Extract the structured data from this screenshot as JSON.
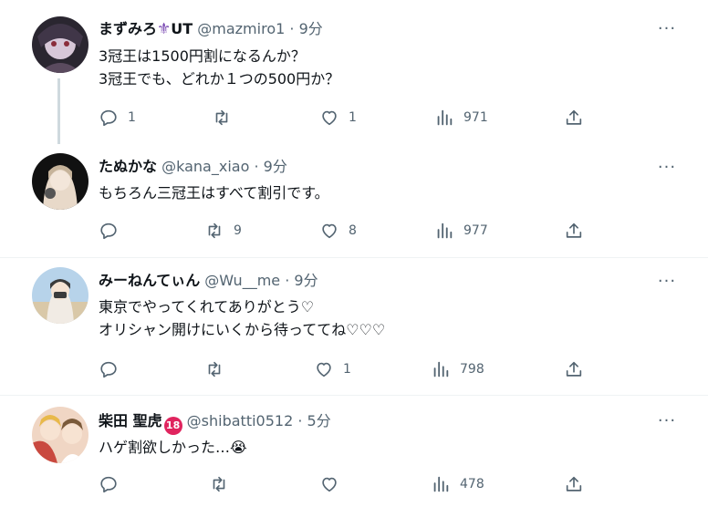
{
  "tweets": [
    {
      "name": "まずみろ",
      "name_suffix_symbol": "⚜",
      "name_suffix": "UT",
      "handle": "@mazmiro1",
      "dot": "·",
      "time": "9分",
      "body": "3冠王は1500円割になるんか？\n3冠王でも、どれか１つの500円か？",
      "replies": "1",
      "retweets": "",
      "likes": "1",
      "views": "971",
      "avatar_colors": [
        "#2a2630",
        "#d7c7d8",
        "#8a2d3b"
      ]
    },
    {
      "name": "たぬかな",
      "handle": "@kana_xiao",
      "dot": "·",
      "time": "9分",
      "body": "もちろん三冠王はすべて割引です。",
      "replies": "",
      "retweets": "9",
      "likes": "8",
      "views": "977",
      "avatar_colors": [
        "#111111",
        "#e8d9c9",
        "#c6b39a"
      ]
    },
    {
      "name": "みーねんてぃん",
      "handle": "@Wu__me",
      "dot": "·",
      "time": "9分",
      "body": "東京でやってくれてありがとう♡\nオリシャン開けにいくから待っててね♡♡♡",
      "replies": "",
      "retweets": "",
      "likes": "1",
      "views": "798",
      "avatar_colors": [
        "#b7d3ea",
        "#f1ebe4",
        "#3b3b3b"
      ]
    },
    {
      "name": "柴田 聖虎",
      "name_badge": "18",
      "handle": "@shibatti0512",
      "dot": "·",
      "time": "5分",
      "body": "ハゲ割欲しかった…😭",
      "replies": "",
      "retweets": "",
      "likes": "",
      "views": "478",
      "avatar_colors": [
        "#f0d6c4",
        "#e8b94a",
        "#c9493f"
      ]
    }
  ],
  "more_label": "···",
  "colors": {
    "text": "#0f1419",
    "muted": "#536471",
    "separator": "#eff3f4",
    "thread_line": "#cfd9de",
    "badge": "#e0245e"
  }
}
